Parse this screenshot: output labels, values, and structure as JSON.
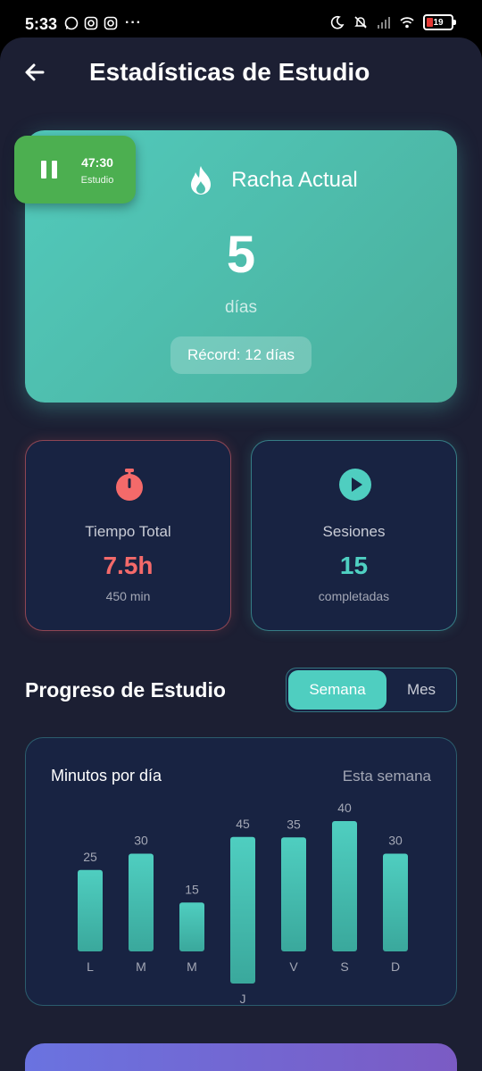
{
  "status_bar": {
    "time": "5:33",
    "battery": "19"
  },
  "header": {
    "title": "Estadísticas de Estudio"
  },
  "timer": {
    "time": "47:30",
    "label": "Estudio"
  },
  "streak": {
    "title": "Racha Actual",
    "value": "5",
    "unit": "días",
    "record": "Récord: 12 días"
  },
  "stats": {
    "total_time": {
      "label": "Tiempo Total",
      "value": "7.5h",
      "sub": "450 min"
    },
    "sessions": {
      "label": "Sesiones",
      "value": "15",
      "sub": "completadas"
    }
  },
  "progress": {
    "title": "Progreso de Estudio",
    "toggle": {
      "week": "Semana",
      "month": "Mes",
      "selected": "Semana"
    }
  },
  "chart_card": {
    "title": "Minutos por día",
    "range": "Esta semana"
  },
  "chart_data": {
    "type": "bar",
    "categories": [
      "L",
      "M",
      "M",
      "J",
      "V",
      "S",
      "D"
    ],
    "values": [
      25,
      30,
      15,
      45,
      35,
      40,
      30
    ],
    "title": "Minutos por día",
    "xlabel": "",
    "ylabel": "",
    "grid": false,
    "color": "#4fcec0"
  },
  "colors": {
    "accent": "#4fcec0",
    "danger": "#f46a6a",
    "timer": "#4caf50",
    "background": "#1c1f33"
  }
}
